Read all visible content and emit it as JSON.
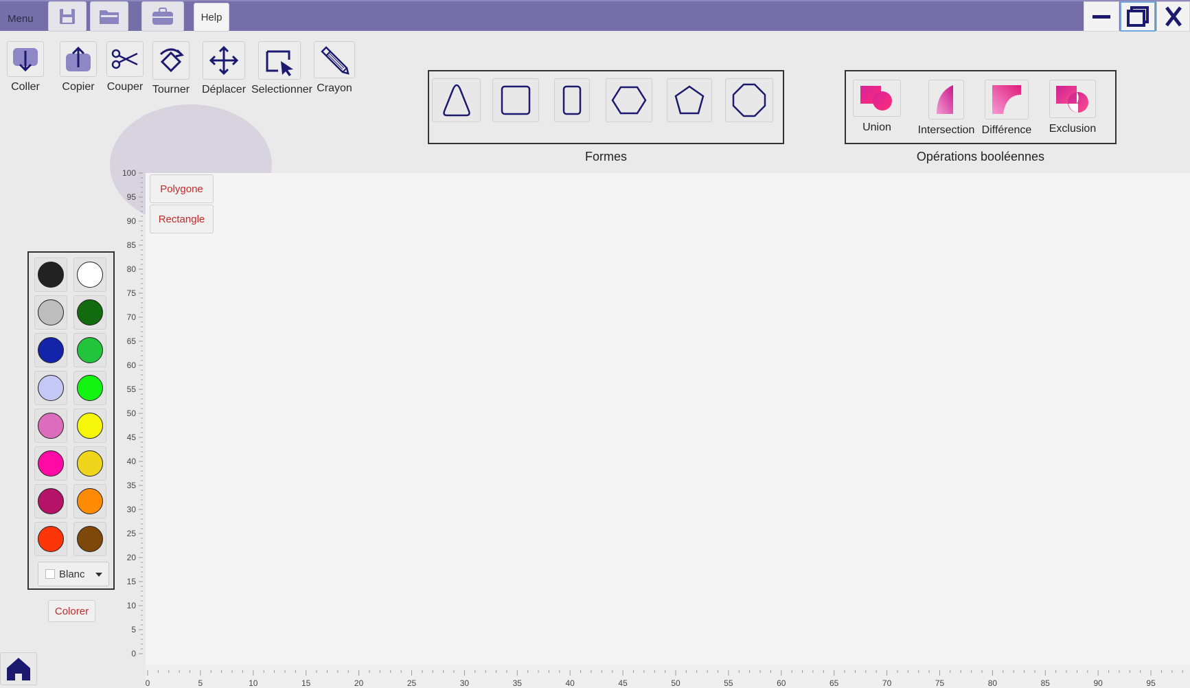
{
  "titlebar": {
    "menu_label": "Menu",
    "help_label": "Help",
    "icons": [
      "save-icon",
      "folder-icon",
      "briefcase-icon"
    ],
    "window_controls": [
      "minimize-icon",
      "restore-icon",
      "close-icon"
    ],
    "background": "#756ea8"
  },
  "toolbar": {
    "items": [
      {
        "label": "Coller",
        "icon": "paste-arrow-down-icon"
      },
      {
        "label": "Copier",
        "icon": "copy-arrow-up-icon"
      },
      {
        "label": "Couper",
        "icon": "scissors-icon"
      },
      {
        "label": "Tourner",
        "icon": "rotate-icon"
      },
      {
        "label": "Déplacer",
        "icon": "move-arrows-icon"
      },
      {
        "label": "Selectionner",
        "icon": "select-cursor-icon"
      },
      {
        "label": "Crayon",
        "icon": "pencil-icon"
      }
    ]
  },
  "shapes": {
    "title": "Formes",
    "items": [
      "triangle-icon",
      "square-icon",
      "rectangle-icon",
      "hexagon-icon",
      "pentagon-icon",
      "octagon-icon"
    ]
  },
  "boolean_ops": {
    "title": "Opérations booléennes",
    "items": [
      {
        "label": "Union",
        "icon": "union-icon"
      },
      {
        "label": "Intersection",
        "icon": "intersection-icon"
      },
      {
        "label": "Différence",
        "icon": "difference-icon"
      },
      {
        "label": "Exclusion",
        "icon": "exclusion-icon"
      }
    ]
  },
  "canvas": {
    "buttons": {
      "polygone": "Polygone",
      "rectangle": "Rectangle"
    }
  },
  "rulers": {
    "y_labels": [
      "100",
      "95",
      "90",
      "85",
      "80",
      "75",
      "70",
      "65",
      "60",
      "55",
      "50",
      "45",
      "40",
      "35",
      "30",
      "25",
      "20",
      "15",
      "10",
      "5",
      "0"
    ],
    "x_labels": [
      "0",
      "5",
      "10",
      "15",
      "20",
      "25",
      "30",
      "35",
      "40",
      "45",
      "50",
      "55",
      "60",
      "65",
      "70",
      "75",
      "80",
      "85",
      "90",
      "95"
    ]
  },
  "palette": {
    "colors": [
      "#222222",
      "#ffffff",
      "#bdbdbd",
      "#136b10",
      "#1424a8",
      "#21c43a",
      "#c4c8f4",
      "#12f312",
      "#dc6dbc",
      "#f6f60b",
      "#ff0aa4",
      "#efd61c",
      "#b41367",
      "#ff8a04",
      "#fc3608",
      "#7e480b"
    ],
    "selected_label": "Blanc",
    "apply_label": "Colorer"
  },
  "accent_red": "#c62828",
  "icon_color": "#1c1a6e"
}
